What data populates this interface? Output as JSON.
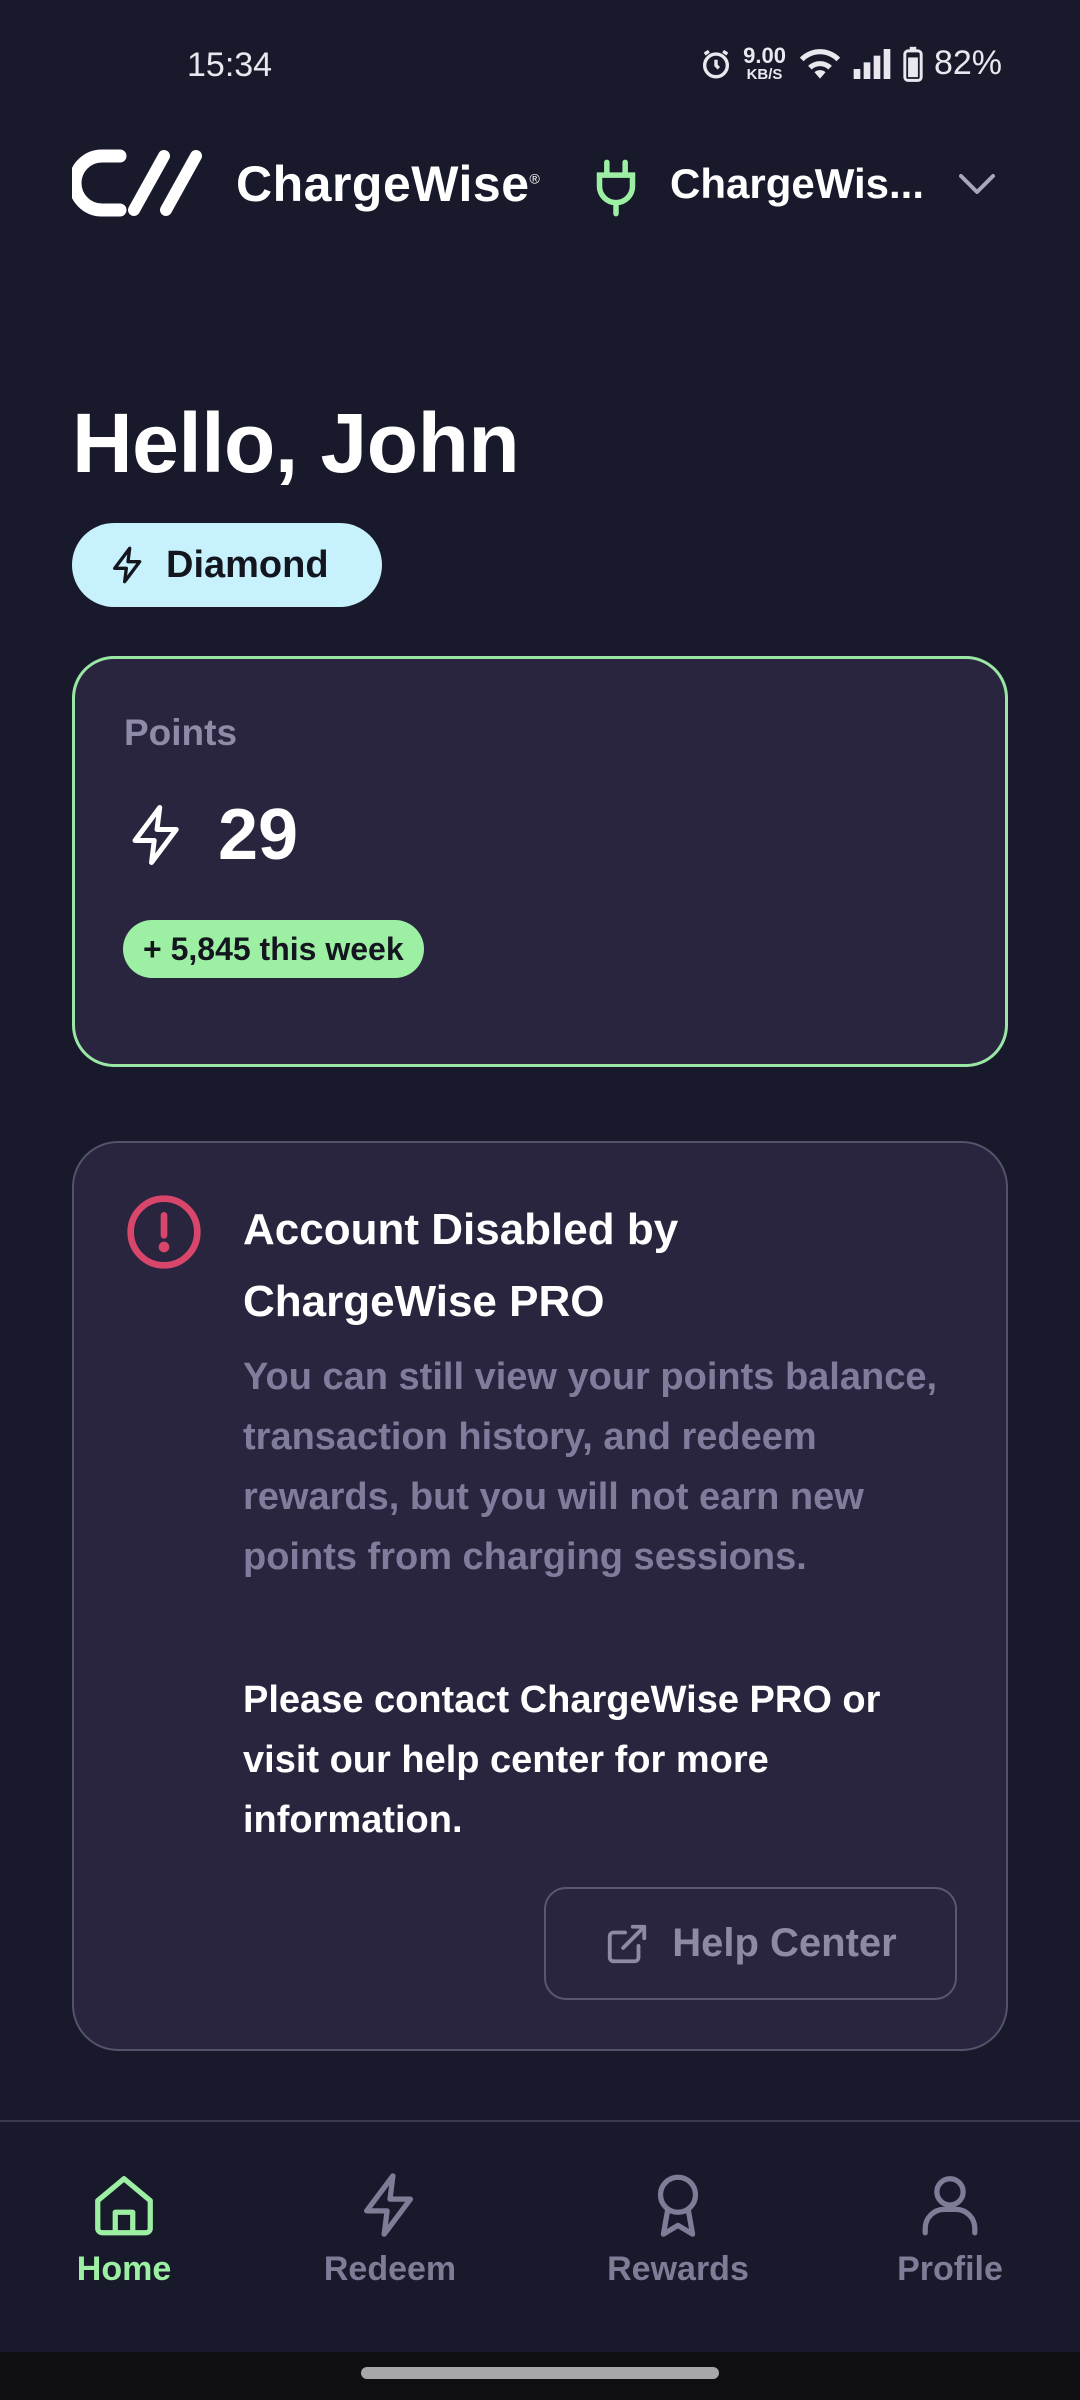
{
  "status_bar": {
    "time": "15:34",
    "speed_value": "9.00",
    "speed_unit": "KB/S",
    "battery_percent": "82%"
  },
  "header": {
    "brand_name": "ChargeWise",
    "brand_mark": "®",
    "station_name": "ChargeWis..."
  },
  "greeting": "Hello, John",
  "tier": {
    "label": "Diamond"
  },
  "points": {
    "label": "Points",
    "value": "29",
    "weekly_change": "+ 5,845 this week"
  },
  "alert": {
    "title": "Account Disabled by ChargeWise PRO",
    "body": "You can still view your points balance, transaction history, and redeem rewards, but you will not earn new points from charging sessions.",
    "contact": "Please contact ChargeWise PRO or visit our help center for more information.",
    "button_label": "Help Center"
  },
  "nav": {
    "items": [
      {
        "label": "Home",
        "icon": "home-icon",
        "active": true
      },
      {
        "label": "Redeem",
        "icon": "lightning-icon",
        "active": false
      },
      {
        "label": "Rewards",
        "icon": "award-icon",
        "active": false
      },
      {
        "label": "Profile",
        "icon": "user-icon",
        "active": false
      }
    ]
  },
  "colors": {
    "background": "#181a2c",
    "card": "#29253f",
    "accent_green": "#9df0a3",
    "tier_badge": "#c7f1fd",
    "alert_red": "#d8476b"
  }
}
